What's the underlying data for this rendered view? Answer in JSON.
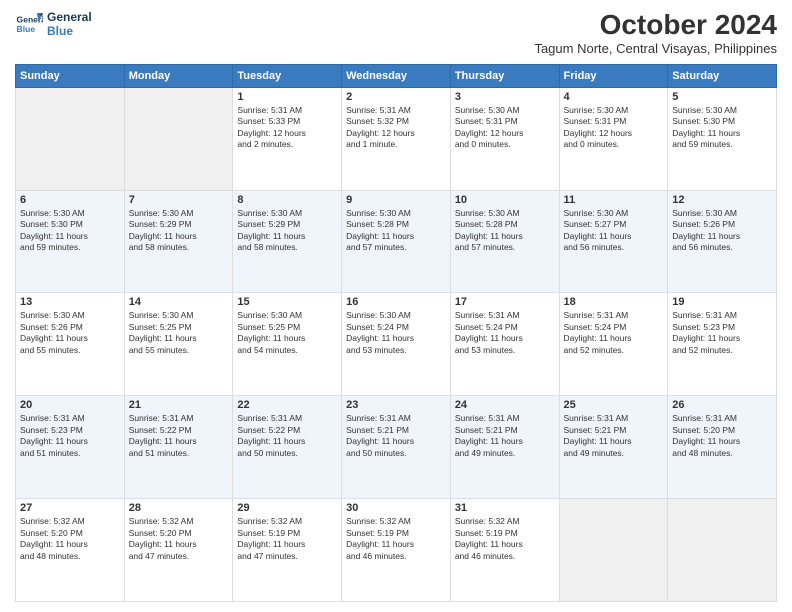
{
  "logo": {
    "line1": "General",
    "line2": "Blue"
  },
  "title": "October 2024",
  "location": "Tagum Norte, Central Visayas, Philippines",
  "weekdays": [
    "Sunday",
    "Monday",
    "Tuesday",
    "Wednesday",
    "Thursday",
    "Friday",
    "Saturday"
  ],
  "weeks": [
    [
      {
        "day": "",
        "text": ""
      },
      {
        "day": "",
        "text": ""
      },
      {
        "day": "1",
        "text": "Sunrise: 5:31 AM\nSunset: 5:33 PM\nDaylight: 12 hours\nand 2 minutes."
      },
      {
        "day": "2",
        "text": "Sunrise: 5:31 AM\nSunset: 5:32 PM\nDaylight: 12 hours\nand 1 minute."
      },
      {
        "day": "3",
        "text": "Sunrise: 5:30 AM\nSunset: 5:31 PM\nDaylight: 12 hours\nand 0 minutes."
      },
      {
        "day": "4",
        "text": "Sunrise: 5:30 AM\nSunset: 5:31 PM\nDaylight: 12 hours\nand 0 minutes."
      },
      {
        "day": "5",
        "text": "Sunrise: 5:30 AM\nSunset: 5:30 PM\nDaylight: 11 hours\nand 59 minutes."
      }
    ],
    [
      {
        "day": "6",
        "text": "Sunrise: 5:30 AM\nSunset: 5:30 PM\nDaylight: 11 hours\nand 59 minutes."
      },
      {
        "day": "7",
        "text": "Sunrise: 5:30 AM\nSunset: 5:29 PM\nDaylight: 11 hours\nand 58 minutes."
      },
      {
        "day": "8",
        "text": "Sunrise: 5:30 AM\nSunset: 5:29 PM\nDaylight: 11 hours\nand 58 minutes."
      },
      {
        "day": "9",
        "text": "Sunrise: 5:30 AM\nSunset: 5:28 PM\nDaylight: 11 hours\nand 57 minutes."
      },
      {
        "day": "10",
        "text": "Sunrise: 5:30 AM\nSunset: 5:28 PM\nDaylight: 11 hours\nand 57 minutes."
      },
      {
        "day": "11",
        "text": "Sunrise: 5:30 AM\nSunset: 5:27 PM\nDaylight: 11 hours\nand 56 minutes."
      },
      {
        "day": "12",
        "text": "Sunrise: 5:30 AM\nSunset: 5:26 PM\nDaylight: 11 hours\nand 56 minutes."
      }
    ],
    [
      {
        "day": "13",
        "text": "Sunrise: 5:30 AM\nSunset: 5:26 PM\nDaylight: 11 hours\nand 55 minutes."
      },
      {
        "day": "14",
        "text": "Sunrise: 5:30 AM\nSunset: 5:25 PM\nDaylight: 11 hours\nand 55 minutes."
      },
      {
        "day": "15",
        "text": "Sunrise: 5:30 AM\nSunset: 5:25 PM\nDaylight: 11 hours\nand 54 minutes."
      },
      {
        "day": "16",
        "text": "Sunrise: 5:30 AM\nSunset: 5:24 PM\nDaylight: 11 hours\nand 53 minutes."
      },
      {
        "day": "17",
        "text": "Sunrise: 5:31 AM\nSunset: 5:24 PM\nDaylight: 11 hours\nand 53 minutes."
      },
      {
        "day": "18",
        "text": "Sunrise: 5:31 AM\nSunset: 5:24 PM\nDaylight: 11 hours\nand 52 minutes."
      },
      {
        "day": "19",
        "text": "Sunrise: 5:31 AM\nSunset: 5:23 PM\nDaylight: 11 hours\nand 52 minutes."
      }
    ],
    [
      {
        "day": "20",
        "text": "Sunrise: 5:31 AM\nSunset: 5:23 PM\nDaylight: 11 hours\nand 51 minutes."
      },
      {
        "day": "21",
        "text": "Sunrise: 5:31 AM\nSunset: 5:22 PM\nDaylight: 11 hours\nand 51 minutes."
      },
      {
        "day": "22",
        "text": "Sunrise: 5:31 AM\nSunset: 5:22 PM\nDaylight: 11 hours\nand 50 minutes."
      },
      {
        "day": "23",
        "text": "Sunrise: 5:31 AM\nSunset: 5:21 PM\nDaylight: 11 hours\nand 50 minutes."
      },
      {
        "day": "24",
        "text": "Sunrise: 5:31 AM\nSunset: 5:21 PM\nDaylight: 11 hours\nand 49 minutes."
      },
      {
        "day": "25",
        "text": "Sunrise: 5:31 AM\nSunset: 5:21 PM\nDaylight: 11 hours\nand 49 minutes."
      },
      {
        "day": "26",
        "text": "Sunrise: 5:31 AM\nSunset: 5:20 PM\nDaylight: 11 hours\nand 48 minutes."
      }
    ],
    [
      {
        "day": "27",
        "text": "Sunrise: 5:32 AM\nSunset: 5:20 PM\nDaylight: 11 hours\nand 48 minutes."
      },
      {
        "day": "28",
        "text": "Sunrise: 5:32 AM\nSunset: 5:20 PM\nDaylight: 11 hours\nand 47 minutes."
      },
      {
        "day": "29",
        "text": "Sunrise: 5:32 AM\nSunset: 5:19 PM\nDaylight: 11 hours\nand 47 minutes."
      },
      {
        "day": "30",
        "text": "Sunrise: 5:32 AM\nSunset: 5:19 PM\nDaylight: 11 hours\nand 46 minutes."
      },
      {
        "day": "31",
        "text": "Sunrise: 5:32 AM\nSunset: 5:19 PM\nDaylight: 11 hours\nand 46 minutes."
      },
      {
        "day": "",
        "text": ""
      },
      {
        "day": "",
        "text": ""
      }
    ]
  ]
}
